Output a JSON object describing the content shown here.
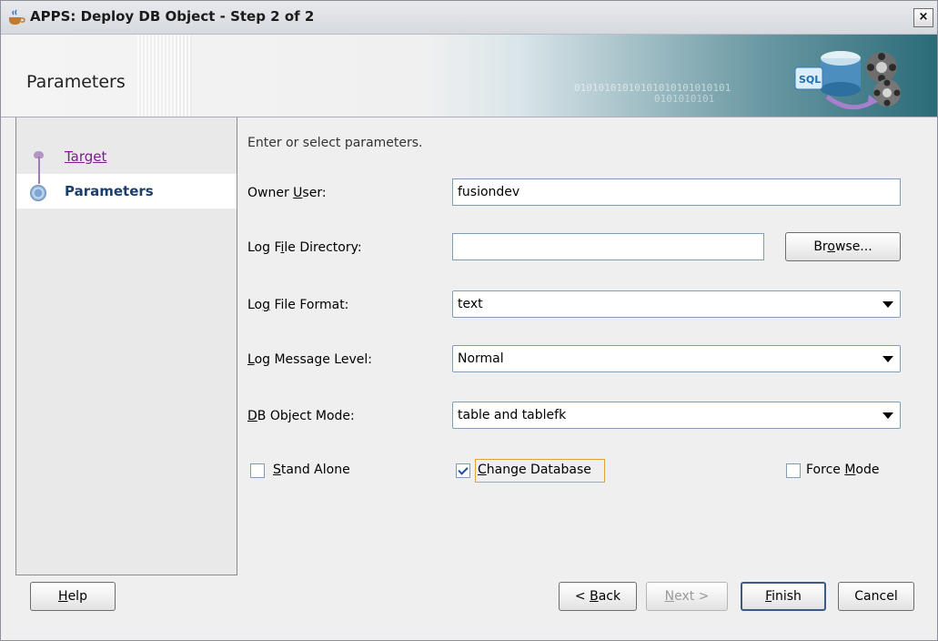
{
  "window": {
    "title": "APPS: Deploy DB Object - Step 2 of 2",
    "close_glyph": "×"
  },
  "banner": {
    "heading": "Parameters",
    "binary1": "01010101010101010101010101",
    "binary2": "0101010101"
  },
  "nav": {
    "items": [
      {
        "label": "Target",
        "state": "link"
      },
      {
        "label": "Parameters",
        "state": "active"
      }
    ]
  },
  "form": {
    "intro": "Enter or select parameters.",
    "owner_user": {
      "label_pre": "Owner ",
      "label_u": "U",
      "label_post": "ser:",
      "value": "fusiondev"
    },
    "log_dir": {
      "label_pre": "Log F",
      "label_u": "i",
      "label_post": "le Directory:",
      "value": ""
    },
    "browse": {
      "pre": "Br",
      "u": "o",
      "post": "wse..."
    },
    "log_format": {
      "label_pre": "Lo",
      "label_u": "g",
      "label_post": " File Format:",
      "value": "text"
    },
    "log_level": {
      "label_pre": "",
      "label_u": "L",
      "label_post": "og Message Level:",
      "value": "Normal"
    },
    "db_mode": {
      "label_pre": "",
      "label_u": "D",
      "label_post": "B Object Mode:",
      "value": "table and tablefk"
    },
    "stand_alone": {
      "pre": "",
      "u": "S",
      "post": "tand Alone",
      "checked": false
    },
    "change_db": {
      "pre": "",
      "u": "C",
      "post": "hange Database",
      "checked": true
    },
    "force_mode": {
      "pre": "Force ",
      "u": "M",
      "post": "ode",
      "checked": false
    }
  },
  "buttons": {
    "help": {
      "pre": "",
      "u": "H",
      "post": "elp"
    },
    "back": {
      "pre": "< ",
      "u": "B",
      "post": "ack"
    },
    "next": {
      "pre": "",
      "u": "N",
      "post": "ext >"
    },
    "finish": {
      "pre": "",
      "u": "F",
      "post": "inish"
    },
    "cancel": {
      "label": "Cancel"
    }
  }
}
